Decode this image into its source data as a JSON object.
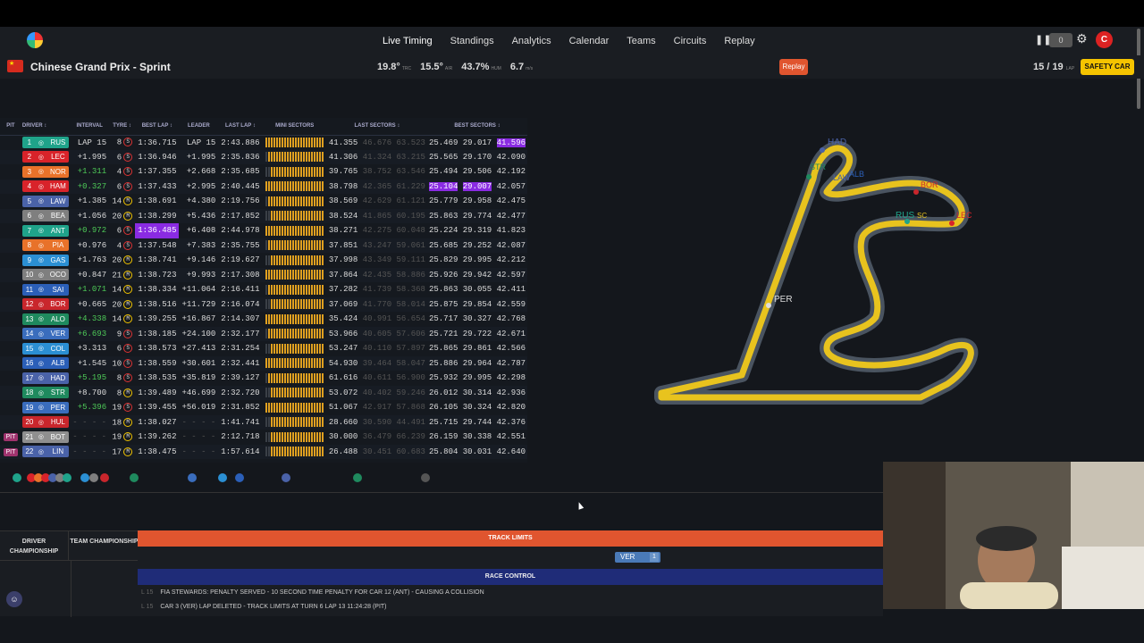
{
  "nav": {
    "links": [
      "Live Timing",
      "Standings",
      "Analytics",
      "Calendar",
      "Teams",
      "Circuits",
      "Replay"
    ],
    "pause": "❚❚",
    "badge": "0",
    "avatar_letter": "C"
  },
  "session": {
    "title": "Chinese Grand Prix - Sprint",
    "weather": [
      {
        "value": "19.8°",
        "unit": "TRC"
      },
      {
        "value": "15.5°",
        "unit": "AIR"
      },
      {
        "value": "43.7%",
        "unit": "HUM"
      },
      {
        "value": "6.7",
        "unit": "m/s"
      }
    ],
    "replay_label": "Replay",
    "lap": "15 / 19",
    "lap_unit": "LAP",
    "status": "SAFETY CAR"
  },
  "table_headers": {
    "pit": "PIT",
    "driver": "DRIVER ↕",
    "interval": "INTERVAL",
    "tyre": "TYRE ↕",
    "best_lap": "BEST LAP ↕",
    "leader": "LEADER",
    "last_lap": "LAST LAP ↕",
    "mini": "MINI SECTORS",
    "last_sectors": "LAST SECTORS ↕",
    "best_sectors": "BEST SECTORS ↕"
  },
  "drivers": [
    {
      "pos": "1",
      "code": "RUS",
      "color": "#1fa38a",
      "pit": "",
      "interval": "LAP 15",
      "tyre_laps": "8",
      "tyre": "S",
      "best": "1:36.715",
      "leader": "LAP 15",
      "last": "2:43.886",
      "ls": [
        "41.355",
        "46.676",
        "63.523"
      ],
      "bs": [
        "25.469",
        "29.017",
        "41.596"
      ]
    },
    {
      "pos": "2",
      "code": "LEC",
      "color": "#d8232a",
      "pit": "",
      "interval": "+1.995",
      "tyre_laps": "6",
      "tyre": "S",
      "best": "1:36.946",
      "leader": "+1.995",
      "last": "2:35.836",
      "ls": [
        "41.306",
        "41.324",
        "63.215"
      ],
      "bs": [
        "25.565",
        "29.170",
        "42.090"
      ]
    },
    {
      "pos": "3",
      "code": "NOR",
      "color": "#e8722a",
      "pit": "",
      "interval": "+1.311",
      "tyre_laps": "4",
      "tyre": "S",
      "best": "1:37.355",
      "leader": "+2.668",
      "last": "2:35.685",
      "ls": [
        "39.765",
        "38.752",
        "63.546"
      ],
      "bs": [
        "25.494",
        "29.506",
        "42.192"
      ]
    },
    {
      "pos": "4",
      "code": "HAM",
      "color": "#d8232a",
      "pit": "",
      "interval": "+0.327",
      "tyre_laps": "6",
      "tyre": "S",
      "best": "1:37.433",
      "leader": "+2.995",
      "last": "2:40.445",
      "ls": [
        "38.798",
        "42.365",
        "61.229"
      ],
      "bs": [
        "25.104",
        "29.007",
        "42.057"
      ]
    },
    {
      "pos": "5",
      "code": "LAW",
      "color": "#4a62a8",
      "pit": "",
      "interval": "+1.385",
      "tyre_laps": "14",
      "tyre": "M",
      "best": "1:38.691",
      "leader": "+4.380",
      "last": "2:19.756",
      "ls": [
        "38.569",
        "42.629",
        "61.121"
      ],
      "bs": [
        "25.779",
        "29.958",
        "42.475"
      ]
    },
    {
      "pos": "6",
      "code": "BEA",
      "color": "#7f7f7f",
      "pit": "",
      "interval": "+1.056",
      "tyre_laps": "20",
      "tyre": "M",
      "best": "1:38.299",
      "leader": "+5.436",
      "last": "2:17.852",
      "ls": [
        "38.524",
        "41.865",
        "60.195"
      ],
      "bs": [
        "25.863",
        "29.774",
        "42.477"
      ]
    },
    {
      "pos": "7",
      "code": "ANT",
      "color": "#1fa38a",
      "pit": "",
      "interval": "+0.972",
      "tyre_laps": "6",
      "tyre": "S",
      "best": "1:36.485",
      "leader": "+6.408",
      "last": "2:44.978",
      "ls": [
        "38.271",
        "42.275",
        "60.048"
      ],
      "bs": [
        "25.224",
        "29.319",
        "41.823"
      ]
    },
    {
      "pos": "8",
      "code": "PIA",
      "color": "#e8722a",
      "pit": "",
      "interval": "+0.976",
      "tyre_laps": "4",
      "tyre": "S",
      "best": "1:37.548",
      "leader": "+7.383",
      "last": "2:35.755",
      "ls": [
        "37.851",
        "43.247",
        "59.061"
      ],
      "bs": [
        "25.685",
        "29.252",
        "42.087"
      ]
    },
    {
      "pos": "9",
      "code": "GAS",
      "color": "#2b8fd3",
      "pit": "",
      "interval": "+1.763",
      "tyre_laps": "20",
      "tyre": "M",
      "best": "1:38.741",
      "leader": "+9.146",
      "last": "2:19.627",
      "ls": [
        "37.998",
        "43.349",
        "59.111"
      ],
      "bs": [
        "25.829",
        "29.995",
        "42.212"
      ]
    },
    {
      "pos": "10",
      "code": "OCO",
      "color": "#7f7f7f",
      "pit": "",
      "interval": "+0.847",
      "tyre_laps": "21",
      "tyre": "M",
      "best": "1:38.723",
      "leader": "+9.993",
      "last": "2:17.308",
      "ls": [
        "37.864",
        "42.435",
        "58.886"
      ],
      "bs": [
        "25.926",
        "29.942",
        "42.597"
      ]
    },
    {
      "pos": "11",
      "code": "SAI",
      "color": "#2b5fb8",
      "pit": "",
      "interval": "+1.071",
      "tyre_laps": "14",
      "tyre": "M",
      "best": "1:38.334",
      "leader": "+11.064",
      "last": "2:16.411",
      "ls": [
        "37.282",
        "41.739",
        "58.368"
      ],
      "bs": [
        "25.863",
        "30.055",
        "42.411"
      ]
    },
    {
      "pos": "12",
      "code": "BOR",
      "color": "#c9262c",
      "pit": "",
      "interval": "+0.665",
      "tyre_laps": "20",
      "tyre": "M",
      "best": "1:38.516",
      "leader": "+11.729",
      "last": "2:16.074",
      "ls": [
        "37.069",
        "41.770",
        "58.014"
      ],
      "bs": [
        "25.875",
        "29.854",
        "42.559"
      ]
    },
    {
      "pos": "13",
      "code": "ALO",
      "color": "#1f8a5e",
      "pit": "",
      "interval": "+4.338",
      "tyre_laps": "14",
      "tyre": "M",
      "best": "1:39.255",
      "leader": "+16.867",
      "last": "2:14.307",
      "ls": [
        "35.424",
        "40.991",
        "56.654"
      ],
      "bs": [
        "25.717",
        "30.327",
        "42.768"
      ]
    },
    {
      "pos": "14",
      "code": "VER",
      "color": "#3a6dbd",
      "pit": "",
      "interval": "+6.693",
      "tyre_laps": "9",
      "tyre": "S",
      "best": "1:38.185",
      "leader": "+24.100",
      "last": "2:32.177",
      "ls": [
        "53.966",
        "40.605",
        "57.606"
      ],
      "bs": [
        "25.721",
        "29.722",
        "42.671"
      ]
    },
    {
      "pos": "15",
      "code": "COL",
      "color": "#2b8fd3",
      "pit": "",
      "interval": "+3.313",
      "tyre_laps": "6",
      "tyre": "S",
      "best": "1:38.573",
      "leader": "+27.413",
      "last": "2:31.254",
      "ls": [
        "53.247",
        "40.110",
        "57.897"
      ],
      "bs": [
        "25.865",
        "29.861",
        "42.566"
      ]
    },
    {
      "pos": "16",
      "code": "ALB",
      "color": "#2b5fb8",
      "pit": "",
      "interval": "+1.545",
      "tyre_laps": "10",
      "tyre": "S",
      "best": "1:38.559",
      "leader": "+30.601",
      "last": "2:32.441",
      "ls": [
        "54.930",
        "39.464",
        "58.047"
      ],
      "bs": [
        "25.886",
        "29.964",
        "42.787"
      ]
    },
    {
      "pos": "17",
      "code": "HAD",
      "color": "#4a62a8",
      "pit": "",
      "interval": "+5.195",
      "tyre_laps": "8",
      "tyre": "S",
      "best": "1:38.535",
      "leader": "+35.819",
      "last": "2:39.127",
      "ls": [
        "61.616",
        "40.611",
        "56.900"
      ],
      "bs": [
        "25.932",
        "29.995",
        "42.298"
      ]
    },
    {
      "pos": "18",
      "code": "STR",
      "color": "#1f8a5e",
      "pit": "",
      "interval": "+8.700",
      "tyre_laps": "8",
      "tyre": "M",
      "best": "1:39.489",
      "leader": "+46.699",
      "last": "2:32.720",
      "ls": [
        "53.072",
        "40.402",
        "59.246"
      ],
      "bs": [
        "26.012",
        "30.314",
        "42.936"
      ]
    },
    {
      "pos": "19",
      "code": "PER",
      "color": "#3a6dbd",
      "pit": "",
      "interval": "+5.396",
      "tyre_laps": "19",
      "tyre": "S",
      "best": "1:39.455",
      "leader": "+56.019",
      "last": "2:31.852",
      "ls": [
        "51.067",
        "42.917",
        "57.868"
      ],
      "bs": [
        "26.105",
        "30.324",
        "42.820"
      ]
    },
    {
      "pos": "20",
      "code": "HUL",
      "color": "#c9262c",
      "pit": "",
      "interval": "- - - -",
      "tyre_laps": "18",
      "tyre": "M",
      "best": "1:38.027",
      "leader": "- - - -",
      "last": "1:41.741",
      "ls": [
        "28.660",
        "30.590",
        "44.491"
      ],
      "bs": [
        "25.715",
        "29.744",
        "42.376"
      ]
    },
    {
      "pos": "21",
      "code": "BOT",
      "color": "#8f8f8f",
      "pit": "PIT",
      "interval": "- - - -",
      "tyre_laps": "19",
      "tyre": "M",
      "best": "1:39.262",
      "leader": "- - - -",
      "last": "2:12.718",
      "ls": [
        "30.000",
        "36.479",
        "66.239"
      ],
      "bs": [
        "26.159",
        "30.338",
        "42.551"
      ]
    },
    {
      "pos": "22",
      "code": "LIN",
      "color": "#4a62a8",
      "pit": "PIT",
      "interval": "- - - -",
      "tyre_laps": "17",
      "tyre": "M",
      "best": "1:38.475",
      "leader": "- - - -",
      "last": "1:57.614",
      "ls": [
        "26.488",
        "30.451",
        "60.683"
      ],
      "bs": [
        "25.804",
        "30.031",
        "42.640"
      ]
    }
  ],
  "track_labels": [
    "HAD",
    "STR",
    "LAW",
    "ALB",
    "BOR",
    "RUS",
    "SC",
    "LEC",
    "PER"
  ],
  "champ": {
    "driver": "DRIVER CHAMPIONSHIP",
    "team": "TEAM CHAMPIONSHIP"
  },
  "track_limits": {
    "title": "TRACK LIMITS",
    "chip": "VER",
    "count": "1"
  },
  "race_control": {
    "title": "RACE CONTROL",
    "messages": [
      {
        "lap": "L 15",
        "text": "FIA STEWARDS: PENALTY SERVED - 10 SECOND TIME PENALTY FOR CAR 12 (ANT) - CAUSING A COLLISION"
      },
      {
        "lap": "L 15",
        "text": "CAR 3 (VER) LAP DELETED - TRACK LIMITS AT TURN 6 LAP 13 11:24:28 (PIT)"
      }
    ]
  },
  "colors": {
    "accent": "#e0552f",
    "safety_car": "#f5c400",
    "race_control": "#1f2c78",
    "purple": "#8a2be2"
  }
}
